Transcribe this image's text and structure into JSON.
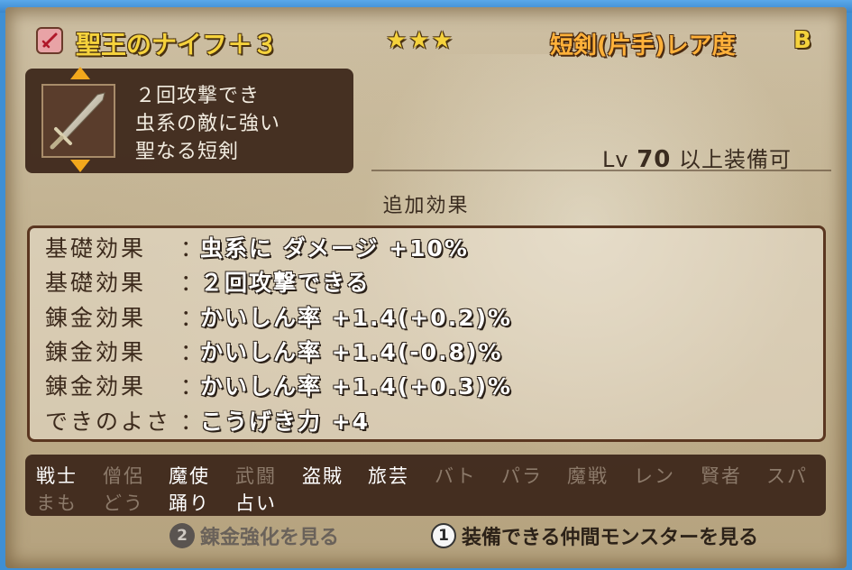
{
  "item": {
    "name": "聖王のナイフ＋３",
    "stars": "★★★",
    "category": "短剣(片手)レア度",
    "rarity": "B",
    "icon": "dagger-icon"
  },
  "description": [
    "２回攻撃でき",
    "虫系の敵に強い",
    "聖なる短剣"
  ],
  "level_requirement": {
    "prefix": "Lv",
    "level": "70",
    "suffix": "以上装備可"
  },
  "effects_title": "追加効果",
  "effects": [
    {
      "label": "基礎効果",
      "colon": "：",
      "value": "虫系に ダメージ +10%"
    },
    {
      "label": "基礎効果",
      "colon": "：",
      "value": "２回攻撃できる"
    },
    {
      "label": "錬金効果",
      "colon": "：",
      "value": "かいしん率 +1.4(+0.2)%"
    },
    {
      "label": "錬金効果",
      "colon": "：",
      "value": "かいしん率 +1.4(-0.8)%"
    },
    {
      "label": "錬金効果",
      "colon": "：",
      "value": "かいしん率 +1.4(+0.3)%"
    },
    {
      "label": "できのよさ",
      "colon": "：",
      "value": "こうげき力 +4"
    }
  ],
  "jobs": {
    "row1": [
      "戦士",
      "僧侶",
      "魔使",
      "武闘",
      "盗賊",
      "旅芸",
      "バト",
      "パラ",
      "魔戦",
      "レン",
      "賢者",
      "スパ"
    ],
    "row2": [
      "まも",
      "どう",
      "踊り",
      "占い"
    ]
  },
  "buttons": {
    "alchemy": {
      "key": "2",
      "label": "錬金強化を見る"
    },
    "monsters": {
      "key": "1",
      "label": "装備できる仲間モンスターを見る"
    }
  },
  "colors": {
    "gold": "#f5d23c",
    "orange": "#ffb13a",
    "panel": "#3a2418"
  }
}
